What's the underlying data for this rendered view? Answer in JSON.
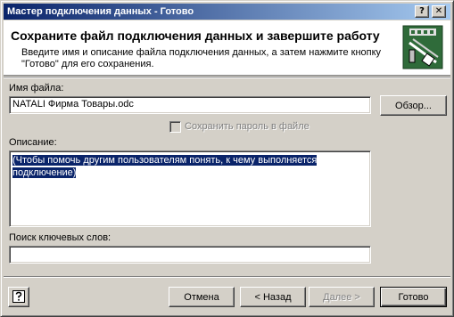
{
  "window": {
    "title": "Мастер подключения данных - Готово",
    "help_glyph": "?",
    "close_glyph": "✕"
  },
  "header": {
    "title": "Сохраните файл подключения данных и завершите работу",
    "description": "Введите имя и описание файла подключения данных, а затем нажмите кнопку \"Готово\" для его сохранения."
  },
  "form": {
    "filename_label": "Имя файла:",
    "filename_value": "NATALI Фирма Товары.odc",
    "browse_label": "Обзор...",
    "save_password_label": "Сохранить пароль в файле",
    "save_password_checked": false,
    "description_label": "Описание:",
    "description_value": "(Чтобы помочь другим пользователям понять, к чему выполняется подключение)",
    "keywords_label": "Поиск ключевых слов:",
    "keywords_value": ""
  },
  "footer": {
    "cancel_label": "Отмена",
    "back_label": "< Назад",
    "next_label": "Далее >",
    "finish_label": "Готово"
  },
  "colors": {
    "titlebar_start": "#0a246a",
    "titlebar_end": "#a6caf0",
    "selection": "#0a246a",
    "face": "#d4d0c8",
    "header_icon_bg": "#2f6b3a"
  }
}
